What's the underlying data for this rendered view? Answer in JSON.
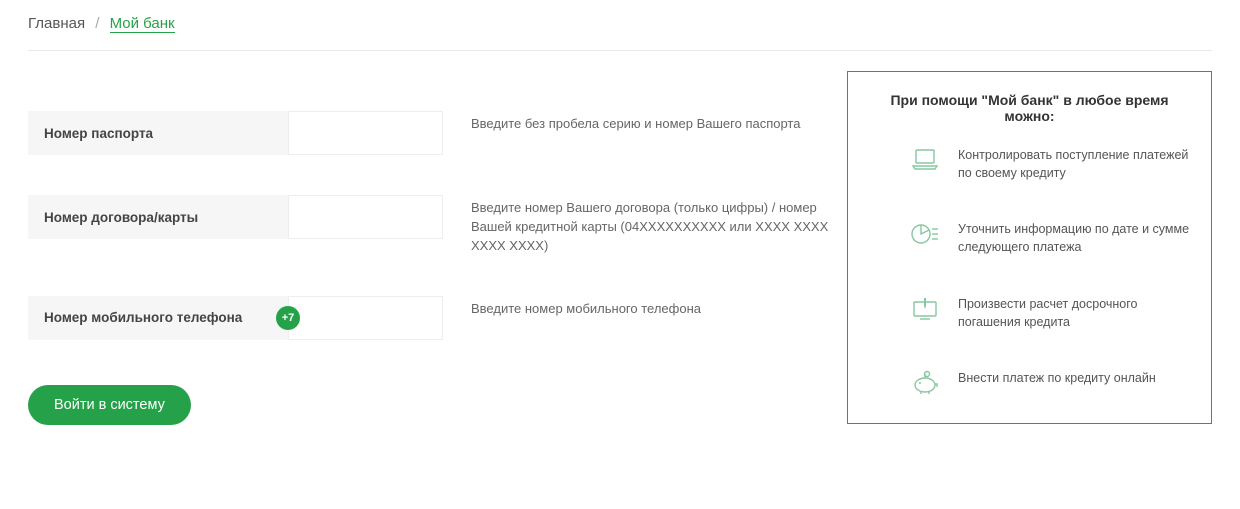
{
  "breadcrumb": {
    "home": "Главная",
    "current": "Мой банк"
  },
  "form": {
    "fields": [
      {
        "label": "Номер паспорта",
        "hint": "Введите без пробела серию и номер Вашего паспорта",
        "prefix": null
      },
      {
        "label": "Номер договора/карты",
        "hint": "Введите номер Вашего договора (только цифры) / номер Вашей кредитной карты (04XXXXXXXXXX или XXXX XXXX XXXX XXXX)",
        "prefix": null
      },
      {
        "label": "Номер мобильного телефона",
        "hint": "Введите номер мобильного телефона",
        "prefix": "+7"
      }
    ],
    "submit": "Войти в систему"
  },
  "info": {
    "title": "При помощи \"Мой банк\" в любое время можно:",
    "items": [
      "Контролировать поступление платежей по своему кредиту",
      "Уточнить информацию по дате и сумме следующего платежа",
      "Произвести расчет досрочного погашения кредита",
      "Внести платеж по кредиту онлайн"
    ]
  }
}
